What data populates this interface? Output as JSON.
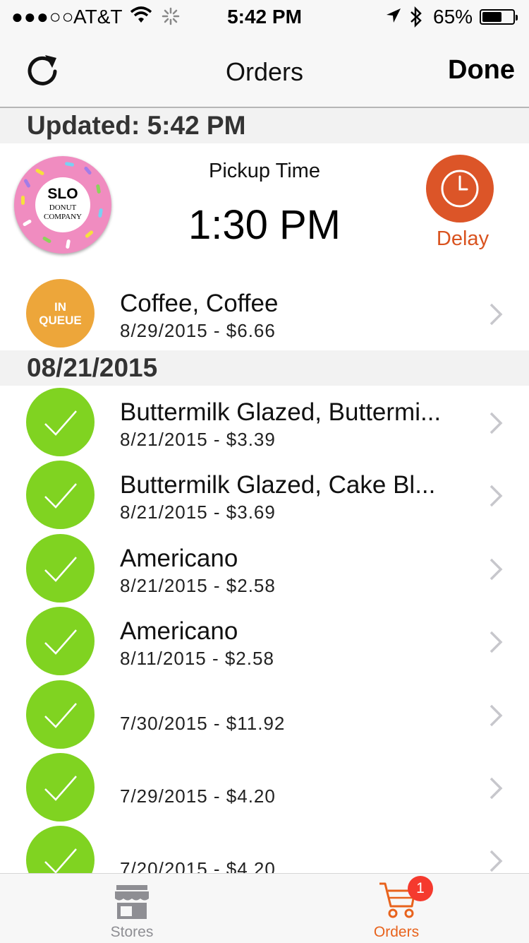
{
  "status_bar": {
    "signal": "●●●○○",
    "carrier": "AT&T",
    "time": "5:42 PM",
    "battery_percent": "65%",
    "battery_level": 0.65,
    "wifi_icon": "wifi-icon",
    "activity_icon": "activity-spinner-icon",
    "location_icon": "location-arrow-icon",
    "bluetooth_icon": "bluetooth-icon"
  },
  "navbar": {
    "title": "Orders",
    "done_label": "Done",
    "refresh_icon": "refresh-icon"
  },
  "updated_header": "Updated: 5:42 PM",
  "pickup": {
    "logo": {
      "line1": "SLO",
      "line2": "DONUT",
      "line3": "COMPANY"
    },
    "label": "Pickup Time",
    "time": "1:30 PM",
    "delay_label": "Delay",
    "delay_icon": "clock-icon"
  },
  "active_order": {
    "status_line1": "IN",
    "status_line2": "QUEUE",
    "title": "Coffee, Coffee",
    "subtitle": "8/29/2015 - $6.66"
  },
  "date_header": "08/21/2015",
  "completed_orders": [
    {
      "title": "Buttermilk Glazed, Buttermi...",
      "subtitle": "8/21/2015 - $3.39"
    },
    {
      "title": "Buttermilk Glazed, Cake Bl...",
      "subtitle": "8/21/2015 - $3.69"
    },
    {
      "title": "Americano",
      "subtitle": "8/21/2015 - $2.58"
    },
    {
      "title": "Americano",
      "subtitle": "8/11/2015 - $2.58"
    },
    {
      "title": "",
      "subtitle": "7/30/2015 - $11.92"
    },
    {
      "title": "",
      "subtitle": "7/29/2015 - $4.20"
    },
    {
      "title": "",
      "subtitle": "7/20/2015 - $4.20"
    }
  ],
  "tabbar": {
    "stores_label": "Stores",
    "orders_label": "Orders",
    "orders_badge": "1",
    "stores_icon": "storefront-icon",
    "orders_icon": "shopping-cart-icon",
    "active_tab": "Orders"
  },
  "colors": {
    "accent": "#e8631d",
    "complete": "#80d321",
    "queue": "#eda63a",
    "delay": "#dc5528",
    "badge": "#f53a2e",
    "inactive_tab": "#8e8e93"
  }
}
